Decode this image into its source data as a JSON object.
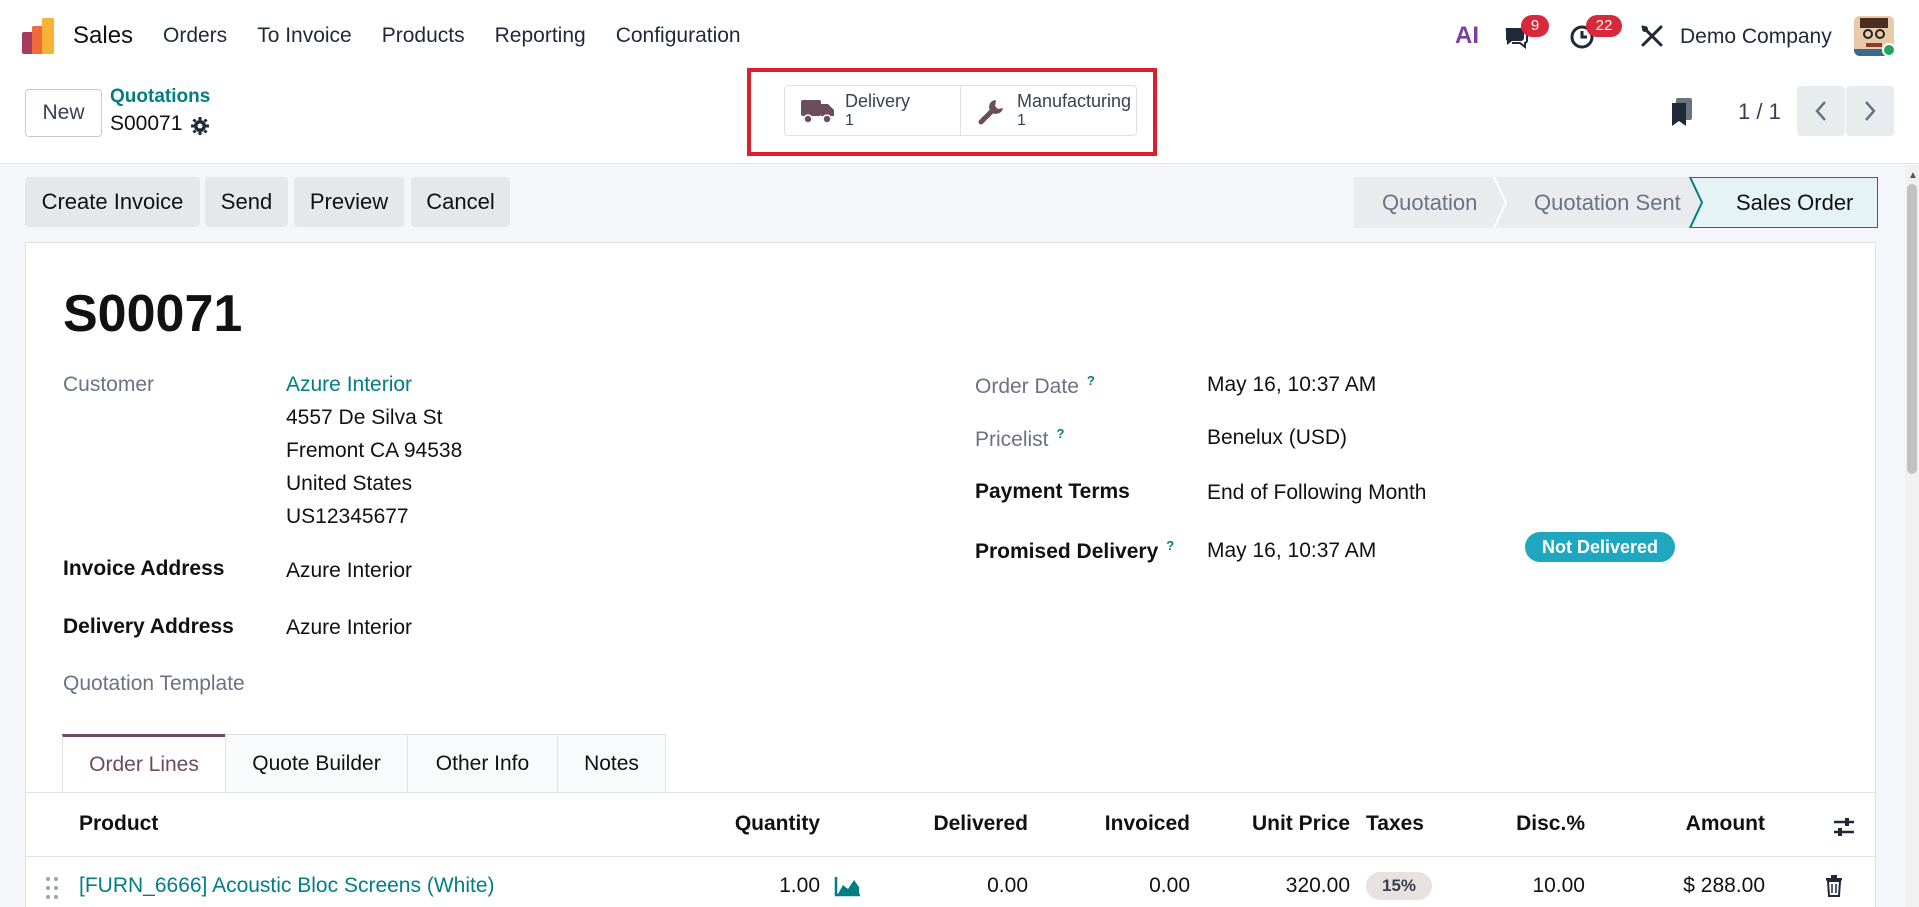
{
  "navbar": {
    "app_name": "Sales",
    "menu": [
      "Orders",
      "To Invoice",
      "Products",
      "Reporting",
      "Configuration"
    ],
    "ai_label": "AI",
    "messages_count": "9",
    "activities_count": "22",
    "company": "Demo Company"
  },
  "control": {
    "new_label": "New",
    "breadcrumb_parent": "Quotations",
    "breadcrumb_current": "S00071",
    "smart_buttons": [
      {
        "label": "Delivery",
        "value": "1"
      },
      {
        "label": "Manufacturing",
        "value": "1"
      }
    ],
    "pager": "1 / 1"
  },
  "actions": {
    "create_invoice": "Create Invoice",
    "send": "Send",
    "preview": "Preview",
    "cancel": "Cancel"
  },
  "status": {
    "stages": [
      "Quotation",
      "Quotation Sent",
      "Sales Order"
    ],
    "current": "Sales Order"
  },
  "form": {
    "title": "S00071",
    "customer_label": "Customer",
    "customer_name": "Azure Interior",
    "customer_address": [
      "4557 De Silva St",
      "Fremont CA 94538",
      "United States",
      "US12345677"
    ],
    "invoice_address_label": "Invoice Address",
    "invoice_address": "Azure Interior",
    "delivery_address_label": "Delivery Address",
    "delivery_address": "Azure Interior",
    "quotation_template_label": "Quotation Template",
    "order_date_label": "Order Date",
    "order_date": "May 16, 10:37 AM",
    "pricelist_label": "Pricelist",
    "pricelist": "Benelux (USD)",
    "payment_terms_label": "Payment Terms",
    "payment_terms": "End of Following Month",
    "promised_delivery_label": "Promised Delivery",
    "promised_delivery": "May 16, 10:37 AM",
    "delivery_status": "Not Delivered",
    "help_mark": "?"
  },
  "tabs": [
    "Order Lines",
    "Quote Builder",
    "Other Info",
    "Notes"
  ],
  "order_lines": {
    "columns": [
      "Product",
      "Quantity",
      "Delivered",
      "Invoiced",
      "Unit Price",
      "Taxes",
      "Disc.%",
      "Amount"
    ],
    "rows": [
      {
        "product": "[FURN_6666] Acoustic Bloc Screens (White)",
        "quantity": "1.00",
        "delivered": "0.00",
        "invoiced": "0.00",
        "unit_price": "320.00",
        "taxes": "15%",
        "discount": "10.00",
        "amount": "$ 288.00"
      }
    ]
  },
  "colors": {
    "accent": "#017e84",
    "highlight": "#dc1f2e",
    "tab_active": "#71485f",
    "badge": "#d8293c",
    "not_delivered": "#1ea7bf"
  }
}
